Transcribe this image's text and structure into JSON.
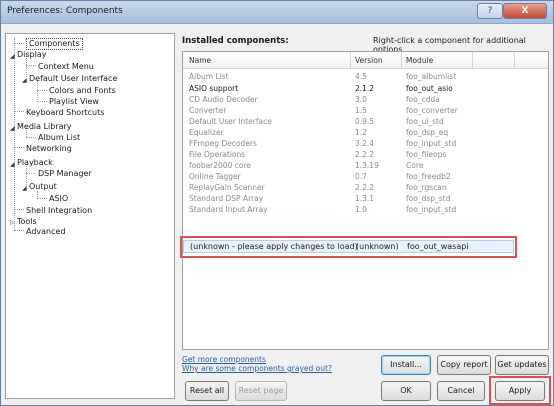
{
  "window": {
    "title": "Preferences: Components",
    "help_label": "?",
    "close_label": "X"
  },
  "tree": [
    {
      "label": "Components",
      "selected": true
    },
    {
      "label": "Display",
      "expanded": true
    },
    {
      "label": "Context Menu"
    },
    {
      "label": "Default User Interface",
      "expanded": true
    },
    {
      "label": "Colors and Fonts"
    },
    {
      "label": "Playlist View"
    },
    {
      "label": "Keyboard Shortcuts"
    },
    {
      "label": "Media Library",
      "expanded": true
    },
    {
      "label": "Album List"
    },
    {
      "label": "Networking"
    },
    {
      "label": "Playback",
      "expanded": true
    },
    {
      "label": "DSP Manager"
    },
    {
      "label": "Output",
      "expanded": true
    },
    {
      "label": "ASIO"
    },
    {
      "label": "Shell Integration"
    },
    {
      "label": "Tools",
      "expanded": false
    },
    {
      "label": "Advanced"
    }
  ],
  "main": {
    "heading": "Installed components:",
    "hint": "Right-click a component for additional options."
  },
  "list": {
    "columns": [
      "Name",
      "Version",
      "Module"
    ],
    "rows": [
      {
        "name": "Album List",
        "version": "4.5",
        "module": "foo_albumlist",
        "style": "gray"
      },
      {
        "name": "ASIO support",
        "version": "2.1.2",
        "module": "foo_out_asio",
        "style": "dark"
      },
      {
        "name": "CD Audio Decoder",
        "version": "3.0",
        "module": "foo_cdda",
        "style": "gray"
      },
      {
        "name": "Converter",
        "version": "1.5",
        "module": "foo_converter",
        "style": "gray"
      },
      {
        "name": "Default User Interface",
        "version": "0.9.5",
        "module": "foo_ui_std",
        "style": "gray"
      },
      {
        "name": "Equalizer",
        "version": "1.2",
        "module": "foo_dsp_eq",
        "style": "gray"
      },
      {
        "name": "FFmpeg Decoders",
        "version": "3.2.4",
        "module": "foo_input_std",
        "style": "gray"
      },
      {
        "name": "File Operations",
        "version": "2.2.2",
        "module": "foo_fileops",
        "style": "gray"
      },
      {
        "name": "foobar2000 core",
        "version": "1.3.19",
        "module": "Core",
        "style": "gray"
      },
      {
        "name": "Online Tagger",
        "version": "0.7",
        "module": "foo_freedb2",
        "style": "gray"
      },
      {
        "name": "ReplayGain Scanner",
        "version": "2.2.2",
        "module": "foo_rgscan",
        "style": "gray"
      },
      {
        "name": "Standard DSP Array",
        "version": "1.3.1",
        "module": "foo_dsp_std",
        "style": "gray"
      },
      {
        "name": "Standard Input Array",
        "version": "1.0",
        "module": "foo_input_std",
        "style": "gray"
      }
    ],
    "new_row": {
      "name": "(unknown - please apply changes to load)",
      "version": "(unknown)",
      "module": "foo_out_wasapi"
    }
  },
  "links": {
    "get_more": "Get more components",
    "grayed_out": "Why are some components grayed out?"
  },
  "buttons": {
    "install": "Install...",
    "copy_report": "Copy report",
    "get_updates": "Get updates",
    "reset_all": "Reset all",
    "reset_page": "Reset page",
    "ok": "OK",
    "cancel": "Cancel",
    "apply": "Apply"
  },
  "colors": {
    "highlight": "#d9534f",
    "link": "#2a5db0",
    "selection": "#eaf1fb"
  }
}
